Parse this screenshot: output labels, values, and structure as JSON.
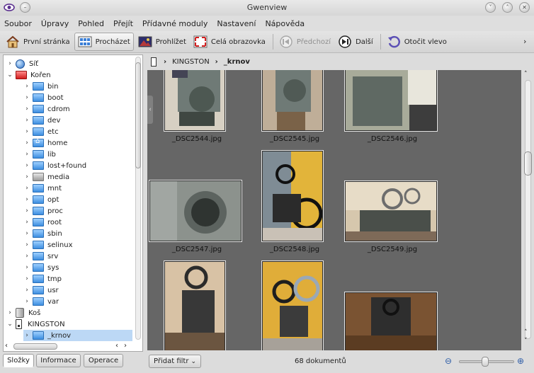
{
  "window": {
    "title": "Gwenview"
  },
  "menubar": [
    "Soubor",
    "Úpravy",
    "Pohled",
    "Přejít",
    "Přídavné moduly",
    "Nastavení",
    "Nápověda"
  ],
  "toolbar": {
    "home_label": "První stránka",
    "browse_label": "Procházet",
    "view_label": "Prohlížet",
    "fullscreen_label": "Celá obrazovka",
    "prev_label": "Předchozí",
    "next_label": "Další",
    "rotate_label": "Otočit vlevo",
    "overflow_icon": "chevron-right-icon"
  },
  "tree": {
    "network_label": "Síť",
    "root_label": "Kořen",
    "root_children": [
      "bin",
      "boot",
      "cdrom",
      "dev",
      "etc",
      "home",
      "lib",
      "lost+found",
      "media",
      "mnt",
      "opt",
      "proc",
      "root",
      "sbin",
      "selinux",
      "srv",
      "sys",
      "tmp",
      "usr",
      "var"
    ],
    "trash_label": "Koš",
    "device_label": "KINGSTON",
    "device_child_label": "_krnov"
  },
  "left_tabs": {
    "folders": "Složky",
    "info": "Informace",
    "operations": "Operace"
  },
  "breadcrumb": {
    "device": "KINGSTON",
    "folder": "_krnov"
  },
  "thumbnails": [
    {
      "label": "_DSC2544.jpg"
    },
    {
      "label": "_DSC2545.jpg"
    },
    {
      "label": "_DSC2546.jpg"
    },
    {
      "label": "_DSC2547.jpg"
    },
    {
      "label": "_DSC2548.jpg"
    },
    {
      "label": "_DSC2549.jpg"
    },
    {
      "label": ""
    },
    {
      "label": ""
    },
    {
      "label": ""
    }
  ],
  "status": {
    "filter_label": "Přidat filtr",
    "document_count": "68 dokumentů",
    "zoom_level": 0.45
  }
}
